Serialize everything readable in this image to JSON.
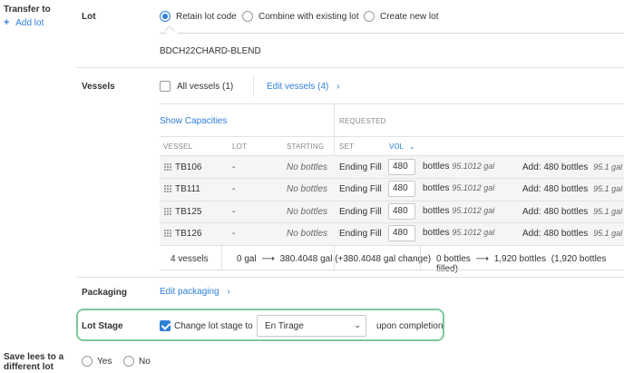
{
  "left": {
    "transfer_to": "Transfer to",
    "add_lot": "Add lot",
    "save_lees_line1": "Save lees to a",
    "save_lees_line2": "different lot"
  },
  "lot": {
    "label": "Lot",
    "options": [
      "Retain lot code",
      "Combine with existing lot",
      "Create new lot"
    ],
    "selected_index": 0,
    "code": "BDCH22CHARD-BLEND"
  },
  "vessels": {
    "label": "Vessels",
    "all_vessels": "All vessels (1)",
    "edit_vessels": "Edit vessels (4)",
    "show_capacities": "Show Capacities",
    "requested": "REQUESTED",
    "headers": {
      "vessel": "VESSEL",
      "lot": "LOT",
      "starting": "STARTING",
      "set": "SET",
      "vol": "VOL"
    },
    "rows": [
      {
        "vessel": "TB106",
        "lot": "-",
        "starting": "No bottles",
        "set": "Ending Fill",
        "vol": "480",
        "bottles": "bottles",
        "gal": "95.1012 gal",
        "add": "Add: 480 bottles",
        "add_gal": "95.1 gal"
      },
      {
        "vessel": "TB111",
        "lot": "-",
        "starting": "No bottles",
        "set": "Ending Fill",
        "vol": "480",
        "bottles": "bottles",
        "gal": "95.1012 gal",
        "add": "Add: 480 bottles",
        "add_gal": "95.1 gal"
      },
      {
        "vessel": "TB125",
        "lot": "-",
        "starting": "No bottles",
        "set": "Ending Fill",
        "vol": "480",
        "bottles": "bottles",
        "gal": "95.1012 gal",
        "add": "Add: 480 bottles",
        "add_gal": "95.1 gal"
      },
      {
        "vessel": "TB126",
        "lot": "-",
        "starting": "No bottles",
        "set": "Ending Fill",
        "vol": "480",
        "bottles": "bottles",
        "gal": "95.1012 gal",
        "add": "Add: 480 bottles",
        "add_gal": "95.1 gal"
      }
    ],
    "summary": {
      "count": "4 vessels",
      "gal_from": "0 gal",
      "gal_to": "380.4048 gal (+380.4048 gal change)",
      "bottles_from": "0 bottles",
      "bottles_to": "1,920 bottles",
      "bottles_note": "(1,920 bottles filled)"
    }
  },
  "packaging": {
    "label": "Packaging",
    "edit": "Edit packaging"
  },
  "lot_stage": {
    "label": "Lot Stage",
    "checkbox_label": "Change lot stage to",
    "checked": true,
    "value": "En Tirage",
    "suffix": "upon completion"
  },
  "save_lees": {
    "options": [
      "Yes",
      "No"
    ]
  },
  "colors": {
    "accent": "#2f7fd6",
    "highlight": "#7cc99a"
  }
}
